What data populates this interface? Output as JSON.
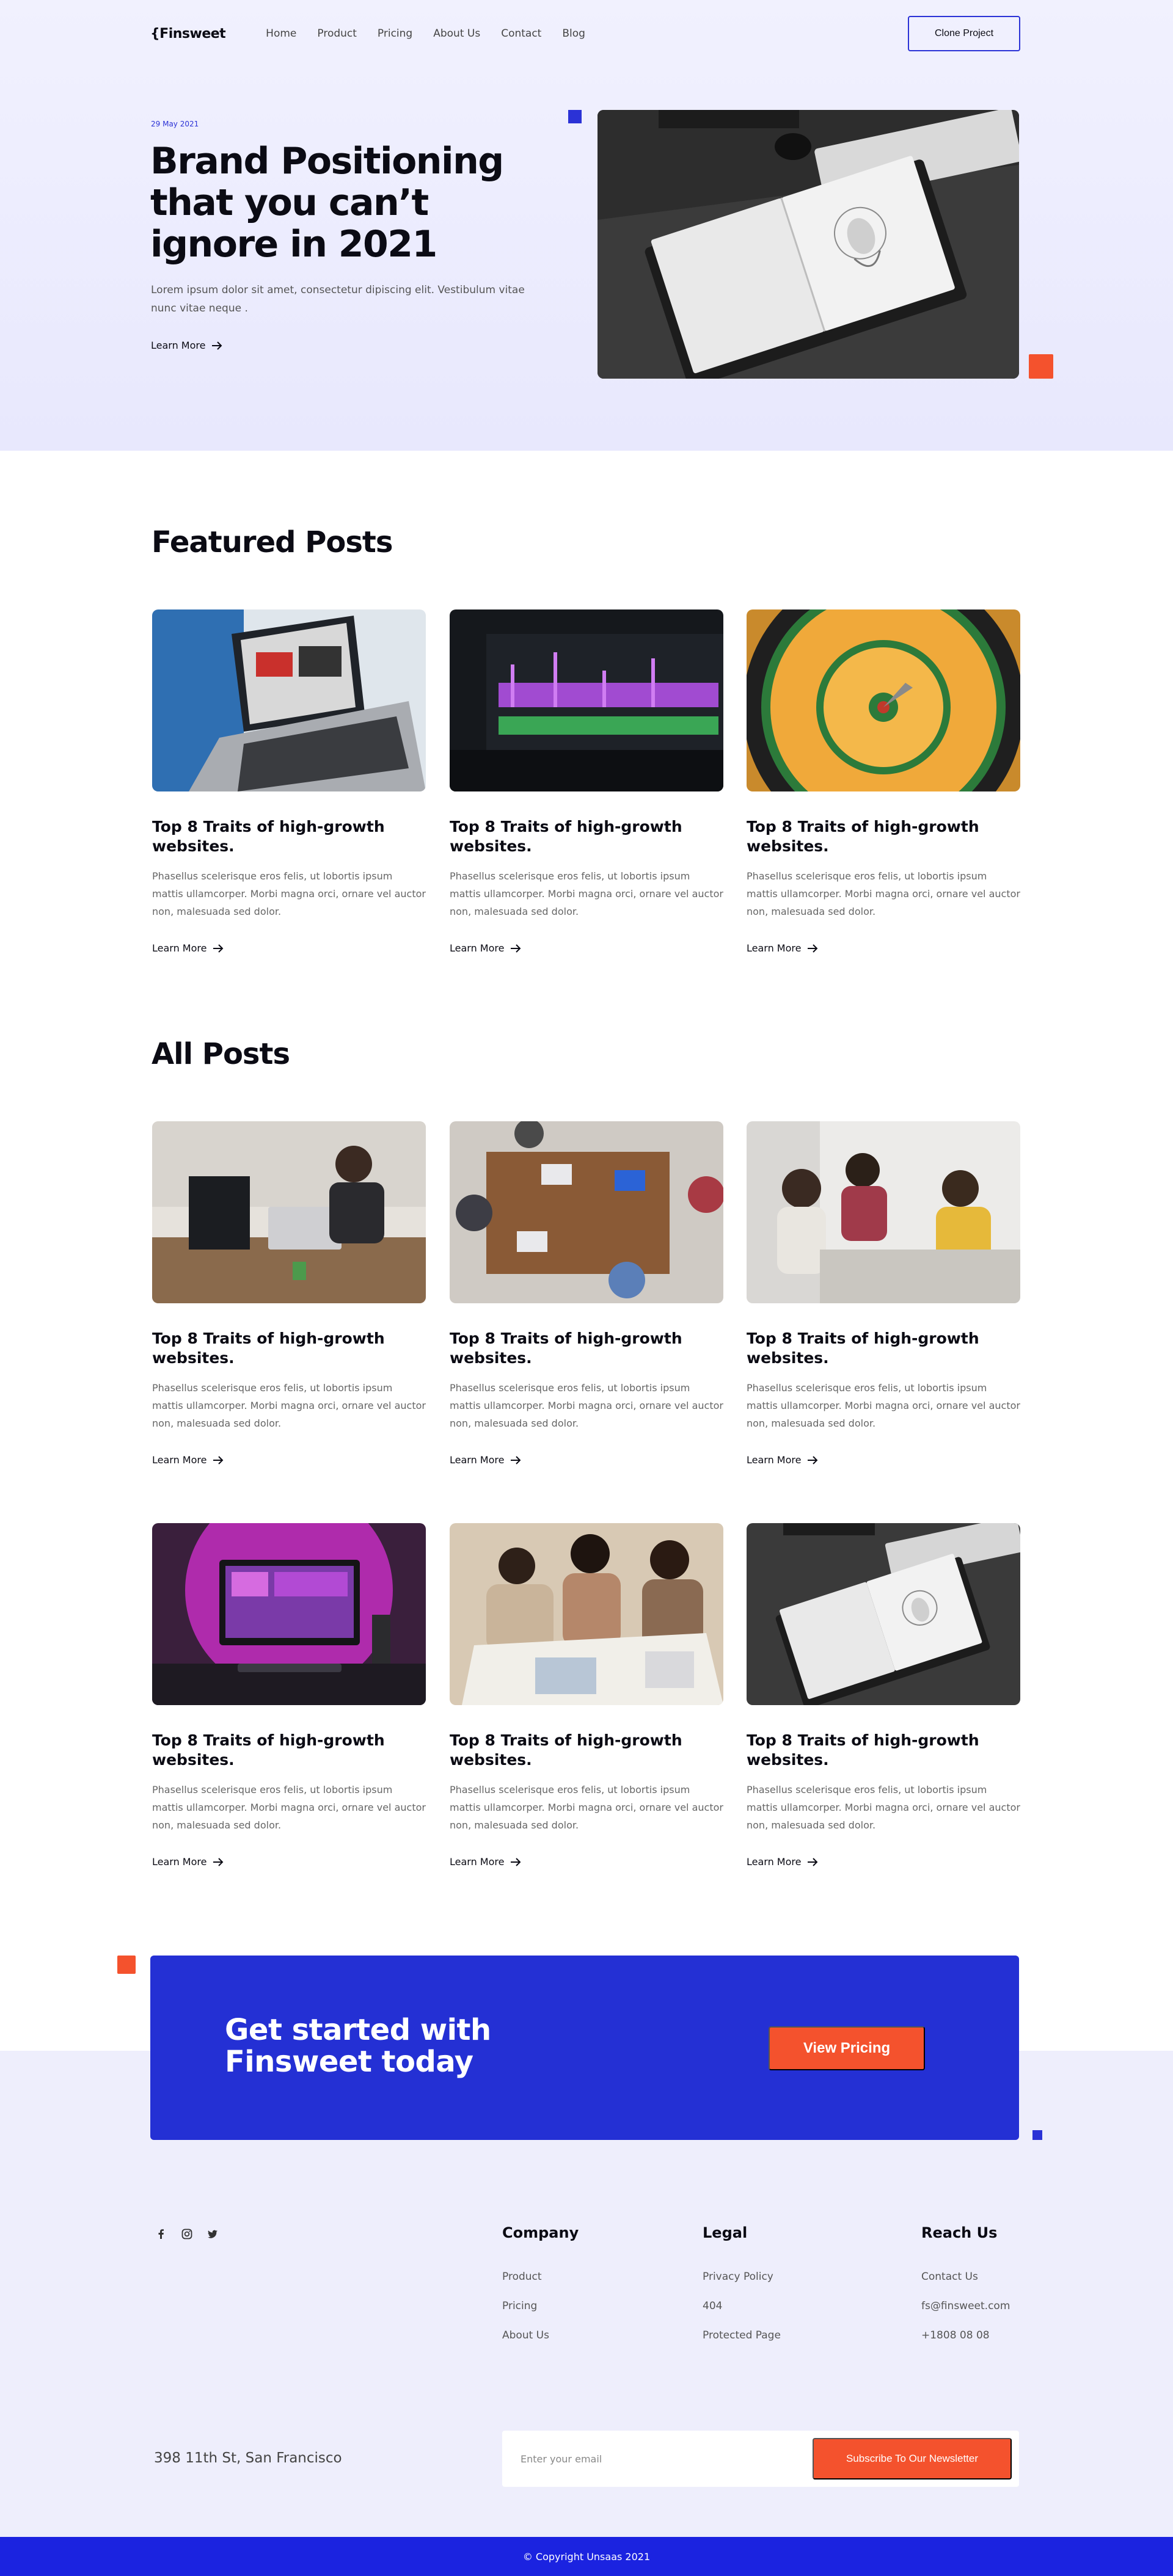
{
  "header": {
    "logo": "{Finsweet",
    "nav": [
      "Home",
      "Product",
      "Pricing",
      "About Us",
      "Contact",
      "Blog"
    ],
    "cta_label": "Clone Project"
  },
  "hero": {
    "date": "29 May 2021",
    "title": "Brand Positioning that you can’t ignore in 2021",
    "description": "Lorem ipsum dolor sit amet, consectetur dipiscing elit. Vestibulum vitae nunc vitae neque .",
    "learn_more": "Learn More"
  },
  "featured": {
    "title": "Featured Posts",
    "posts": [
      {
        "title": "Top 8 Traits of high-growth websites.",
        "desc": "Phasellus scelerisque eros felis, ut lobortis ipsum mattis ullamcorper. Morbi magna orci, ornare vel auctor non, malesuada sed dolor.",
        "link": "Learn More",
        "image": "laptop-on-desk"
      },
      {
        "title": "Top 8 Traits of high-growth websites.",
        "desc": "Phasellus scelerisque eros felis, ut lobortis ipsum mattis ullamcorper. Morbi magna orci, ornare vel auctor non, malesuada sed dolor.",
        "link": "Learn More",
        "image": "video-editing-screen"
      },
      {
        "title": "Top 8 Traits of high-growth websites.",
        "desc": "Phasellus scelerisque eros felis, ut lobortis ipsum mattis ullamcorper. Morbi magna orci, ornare vel auctor non, malesuada sed dolor.",
        "link": "Learn More",
        "image": "dartboard"
      }
    ]
  },
  "all_posts": {
    "title": "All Posts",
    "posts": [
      {
        "title": "Top 8 Traits of high-growth websites.",
        "desc": "Phasellus scelerisque eros felis, ut lobortis ipsum mattis ullamcorper. Morbi magna orci, ornare vel auctor non, malesuada sed dolor.",
        "link": "Learn More",
        "image": "man-at-computer"
      },
      {
        "title": "Top 8 Traits of high-growth websites.",
        "desc": "Phasellus scelerisque eros felis, ut lobortis ipsum mattis ullamcorper. Morbi magna orci, ornare vel auctor non, malesuada sed dolor.",
        "link": "Learn More",
        "image": "team-table-overhead"
      },
      {
        "title": "Top 8 Traits of high-growth websites.",
        "desc": "Phasellus scelerisque eros felis, ut lobortis ipsum mattis ullamcorper. Morbi magna orci, ornare vel auctor non, malesuada sed dolor.",
        "link": "Learn More",
        "image": "team-meeting-laughing"
      },
      {
        "title": "Top 8 Traits of high-growth websites.",
        "desc": "Phasellus scelerisque eros felis, ut lobortis ipsum mattis ullamcorper. Morbi magna orci, ornare vel auctor non, malesuada sed dolor.",
        "link": "Learn More",
        "image": "pink-desk-setup"
      },
      {
        "title": "Top 8 Traits of high-growth websites.",
        "desc": "Phasellus scelerisque eros felis, ut lobortis ipsum mattis ullamcorper. Morbi magna orci, ornare vel auctor non, malesuada sed dolor.",
        "link": "Learn More",
        "image": "team-reviewing-papers"
      },
      {
        "title": "Top 8 Traits of high-growth websites.",
        "desc": "Phasellus scelerisque eros felis, ut lobortis ipsum mattis ullamcorper. Morbi magna orci, ornare vel auctor non, malesuada sed dolor.",
        "link": "Learn More",
        "image": "sketchbook-keyboard"
      }
    ]
  },
  "cta": {
    "title": "Get started with Finsweet today",
    "button": "View Pricing"
  },
  "footer": {
    "socials": [
      "facebook-icon",
      "instagram-icon",
      "twitter-icon"
    ],
    "columns": [
      {
        "heading": "Company",
        "links": [
          "Product",
          "Pricing",
          "About Us"
        ]
      },
      {
        "heading": "Legal",
        "links": [
          "Privacy Policy",
          "404",
          "Protected Page"
        ]
      },
      {
        "heading": "Reach Us",
        "links": [
          "Contact Us",
          "fs@finsweet.com",
          "+1808 08 08"
        ]
      }
    ],
    "address": "398 11th St, San Francisco",
    "newsletter_placeholder": "Enter your email",
    "newsletter_button": "Subscribe To Our Newsletter",
    "copyright": "© Copyright Unsaas 2021"
  },
  "colors": {
    "accent_blue": "#2b32d6",
    "accent_orange": "#f4522d",
    "cta_blue": "#2430d4",
    "footer_bar": "#1b23e0"
  }
}
